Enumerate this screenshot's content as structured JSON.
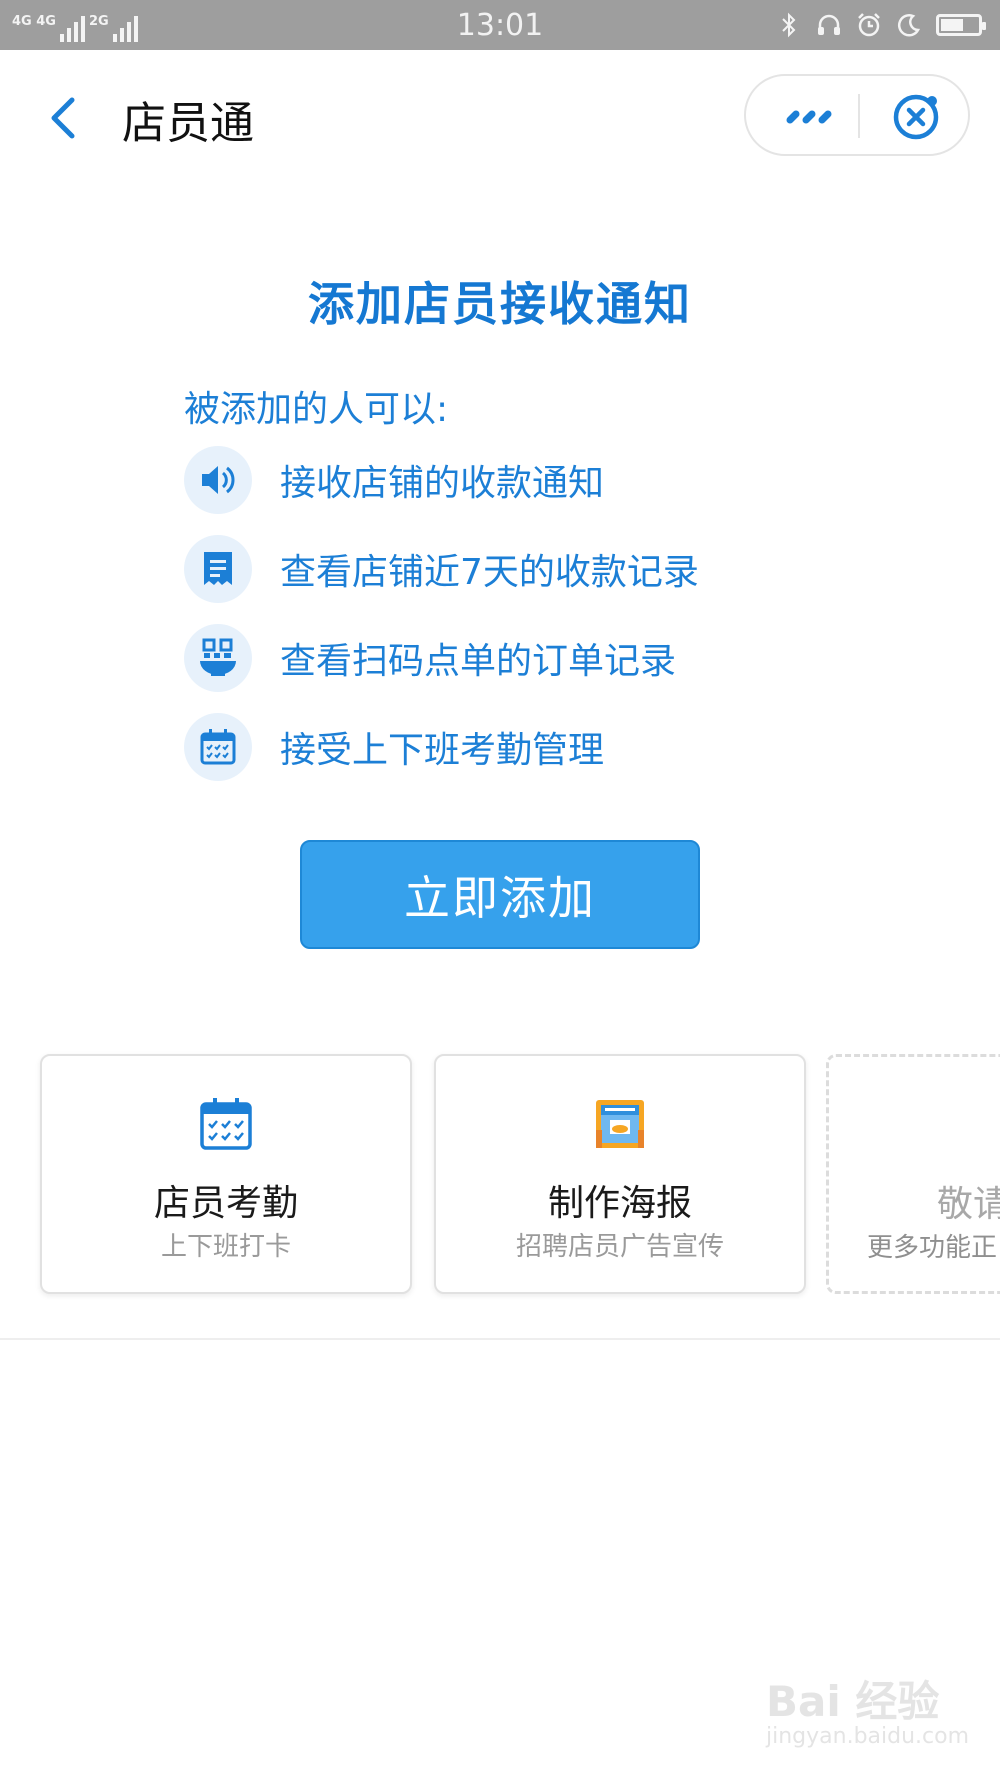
{
  "status_bar": {
    "network_left": "4G 4G",
    "network_right": "2G",
    "time": "13:01",
    "icons": [
      "bluetooth-icon",
      "headset-icon",
      "alarm-icon",
      "moon-icon",
      "battery-icon"
    ],
    "battery_level": 0.5
  },
  "header": {
    "title": "店员通",
    "back_icon": "chevron-left-icon",
    "more_icon": "more-dots-icon",
    "close_icon": "close-circle-icon"
  },
  "main": {
    "title": "添加店员接收通知",
    "subtitle": "被添加的人可以:",
    "features": [
      {
        "icon": "speaker-icon",
        "text": "接收店铺的收款通知"
      },
      {
        "icon": "receipt-icon",
        "text": "查看店铺近7天的收款记录"
      },
      {
        "icon": "qr-bowl-icon",
        "text": "查看扫码点单的订单记录"
      },
      {
        "icon": "calendar-check-icon",
        "text": "接受上下班考勤管理"
      }
    ],
    "add_button": "立即添加"
  },
  "cards": [
    {
      "icon": "calendar-check-icon",
      "name": "店员考勤",
      "sub": "上下班打卡"
    },
    {
      "icon": "poster-icon",
      "name": "制作海报",
      "sub": "招聘店员广告宣传"
    },
    {
      "icon": "",
      "name": "敬请",
      "sub": "更多功能正"
    }
  ],
  "watermark": {
    "main": "Bai 经验",
    "sub": "jingyan.baidu.com"
  },
  "colors": {
    "accent": "#1c7fd6",
    "button": "#36a1ec",
    "status_bar": "#9e9e9e",
    "icon_bg": "#e7f1fb"
  }
}
